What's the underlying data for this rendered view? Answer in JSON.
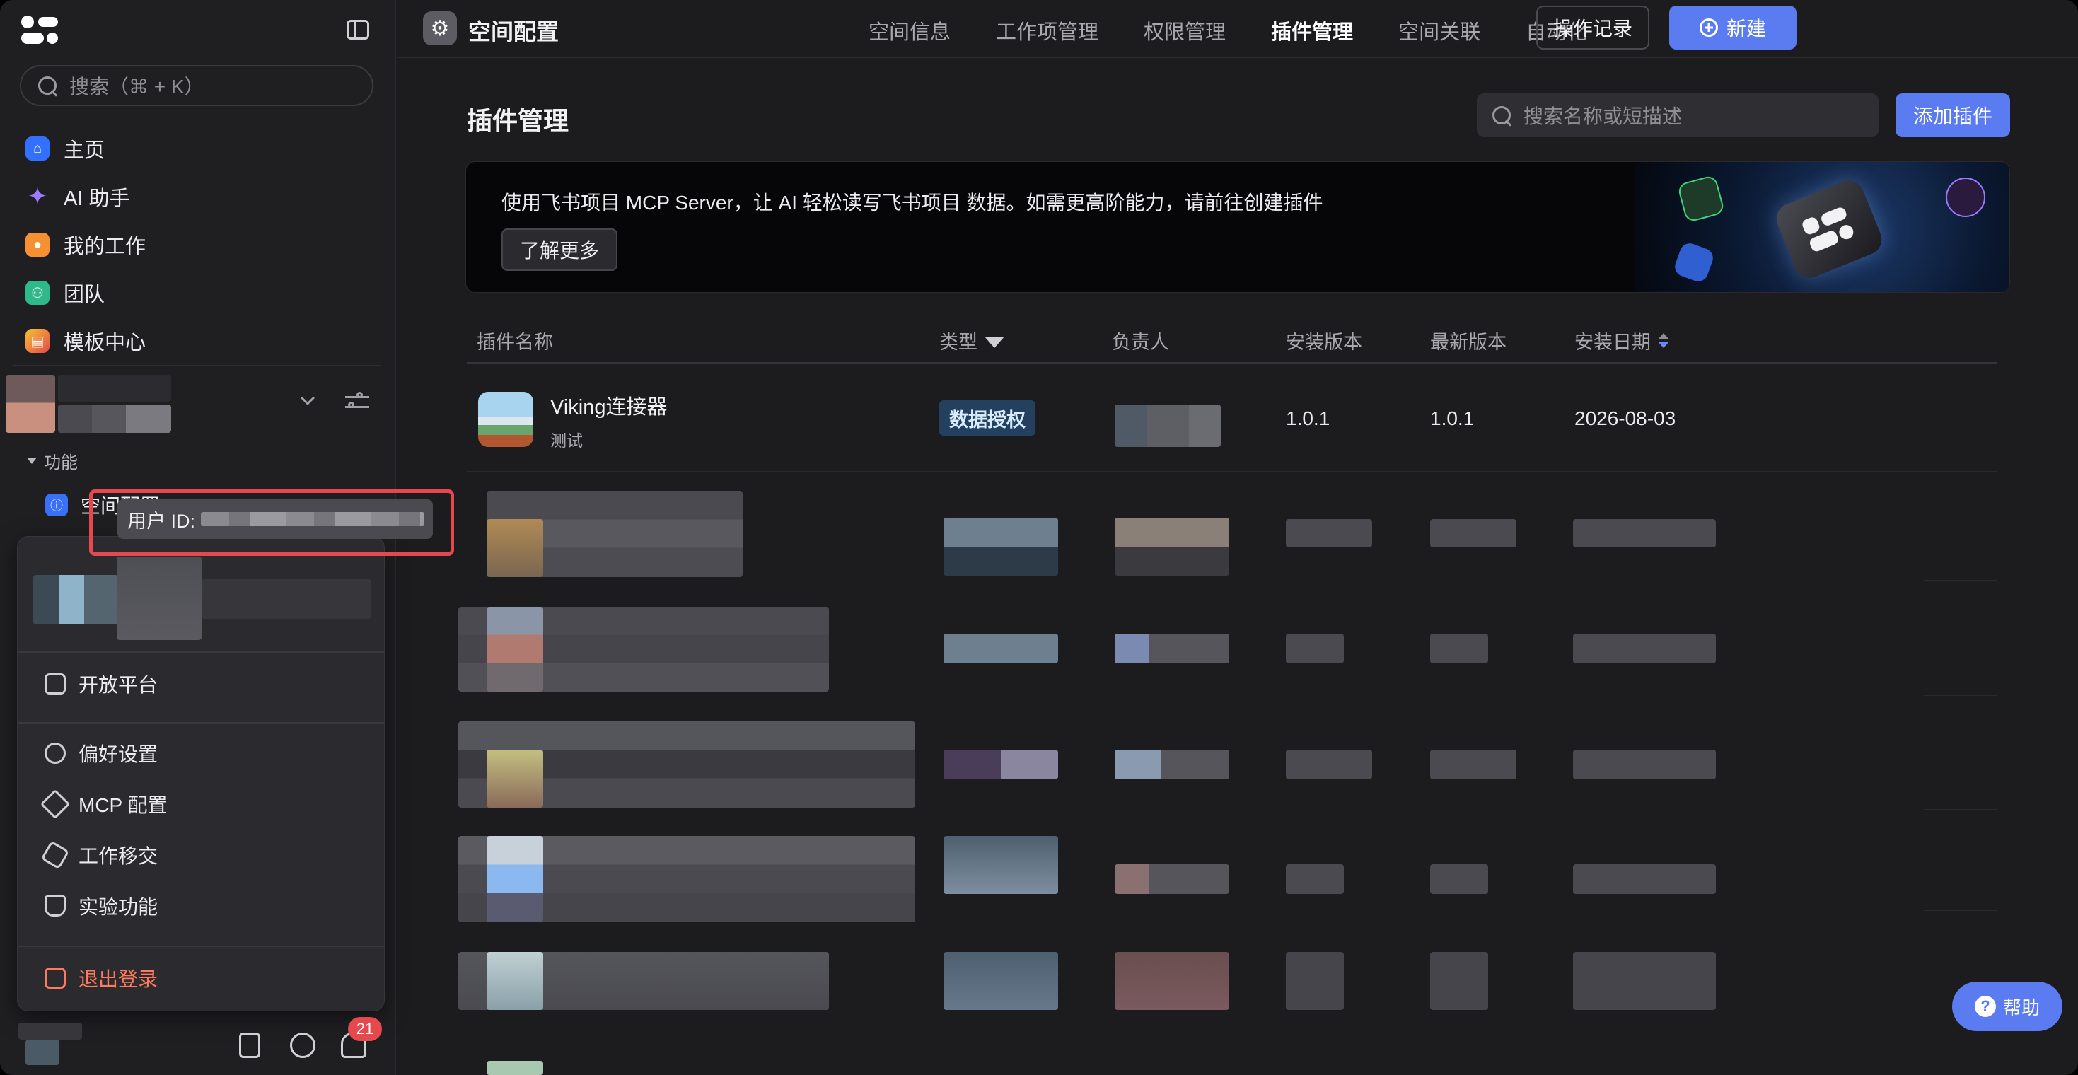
{
  "sidebar": {
    "search_placeholder": "搜索（⌘ + K）",
    "nav": [
      {
        "label": "主页",
        "icon": "home-icon",
        "color": "#3370ff"
      },
      {
        "label": "AI 助手",
        "icon": "sparkle-icon",
        "color": "#8a63f5"
      },
      {
        "label": "我的工作",
        "icon": "person-icon",
        "color": "#f59133"
      },
      {
        "label": "团队",
        "icon": "team-icon",
        "color": "#2fb98a"
      },
      {
        "label": "模板中心",
        "icon": "template-icon",
        "color": "#f5c233"
      }
    ],
    "section_label": "功能",
    "space_item_label": "空间配置",
    "menu": {
      "items": [
        "开放平台",
        "偏好设置",
        "MCP 配置",
        "工作移交",
        "实验功能"
      ],
      "logout": "退出登录"
    },
    "tooltip_label": "用户 ID:",
    "notification_count": "21"
  },
  "header": {
    "title": "空间配置",
    "tabs": [
      "空间信息",
      "工作项管理",
      "权限管理",
      "插件管理",
      "空间关联",
      "自动化"
    ],
    "active_tab": "插件管理",
    "log_button": "操作记录",
    "new_button": "新建"
  },
  "main": {
    "title": "插件管理",
    "search_placeholder": "搜索名称或短描述",
    "add_button": "添加插件",
    "banner": {
      "text": "使用飞书项目 MCP Server，让 AI 轻松读写飞书项目 数据。如需更高阶能力，请前往创建插件",
      "button": "了解更多"
    },
    "columns": [
      "插件名称",
      "类型",
      "负责人",
      "安装版本",
      "最新版本",
      "安装日期"
    ],
    "row": {
      "name": "Viking连接器",
      "desc": "测试",
      "type": "数据授权",
      "installed_version": "1.0.1",
      "latest_version": "1.0.1",
      "install_date": "2026-08-03"
    }
  },
  "help_label": "帮助",
  "colors": {
    "accent": "#5b7bf0",
    "danger": "#e5484d",
    "tag_bg": "#23415e"
  }
}
